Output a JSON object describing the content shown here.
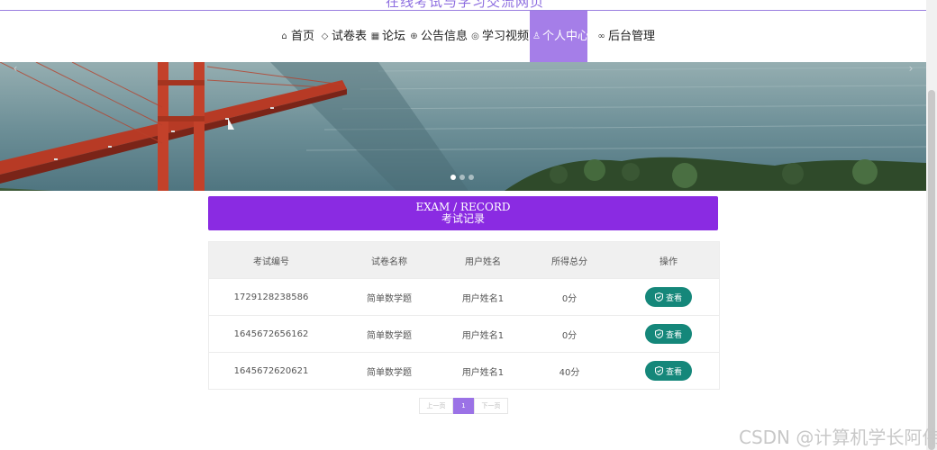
{
  "site": {
    "title": "在线考试与学习交流网页"
  },
  "nav": {
    "items": [
      {
        "label": "首页",
        "icon": "home-icon"
      },
      {
        "label": "试卷表",
        "icon": "tag-icon"
      },
      {
        "label": "论坛",
        "icon": "forum-icon"
      },
      {
        "label": "公告信息",
        "icon": "notice-icon"
      },
      {
        "label": "学习视频",
        "icon": "video-icon"
      },
      {
        "label": "个人中心",
        "icon": "user-icon",
        "active": true
      },
      {
        "label": "后台管理",
        "icon": "link-icon"
      }
    ]
  },
  "section": {
    "title_en": "EXAM / RECORD",
    "title_cn": "考试记录"
  },
  "table": {
    "headers": [
      "考试编号",
      "试卷名称",
      "用户姓名",
      "所得总分",
      "操作"
    ],
    "rows": [
      {
        "id": "1729128238586",
        "paper": "简单数学题",
        "user": "用户姓名1",
        "score": "0分",
        "action": "查看"
      },
      {
        "id": "1645672656162",
        "paper": "简单数学题",
        "user": "用户姓名1",
        "score": "0分",
        "action": "查看"
      },
      {
        "id": "1645672620621",
        "paper": "简单数学题",
        "user": "用户姓名1",
        "score": "40分",
        "action": "查看"
      }
    ]
  },
  "pagination": {
    "prev": "上一页",
    "current": "1",
    "next": "下一页"
  },
  "watermark": "CSDN @计算机学长阿伟",
  "colors": {
    "accent": "#a57ee8",
    "header": "#8a2be2",
    "button": "#15877a"
  }
}
